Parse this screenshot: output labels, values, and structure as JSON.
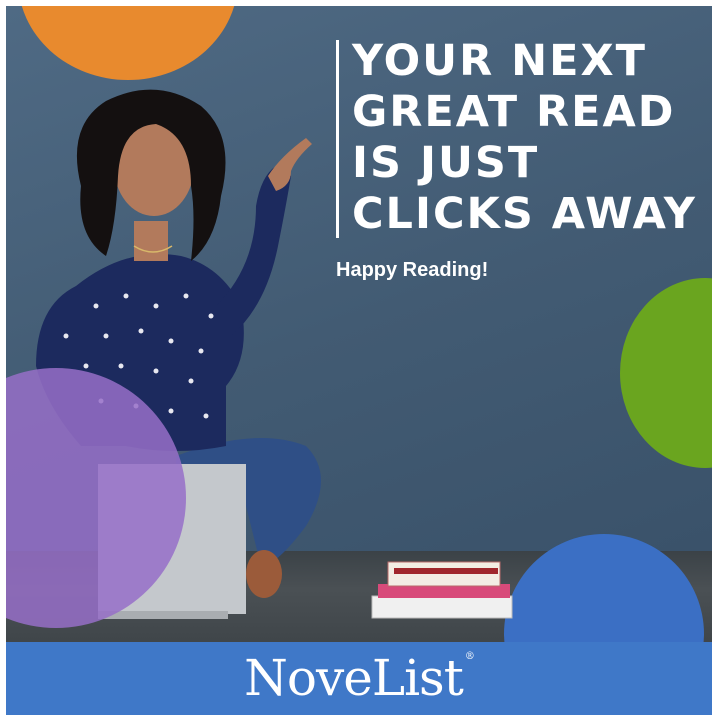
{
  "headline": {
    "lines": [
      "YOUR NEXT",
      "GREAT READ",
      "IS JUST",
      "CLICKS AWAY"
    ]
  },
  "tagline": "Happy Reading!",
  "footer": {
    "logo_text": "NoveList",
    "logo_mark": "®"
  },
  "colors": {
    "orange_circle": "#e88a2e",
    "green_circle": "#6aa51f",
    "blue_circle": "#3b6fc4",
    "purple_circle": "#966ec8",
    "footer_bar": "#3f78c8",
    "wall": "#445e78"
  },
  "photo": {
    "subject": "woman-pointing-up"
  }
}
